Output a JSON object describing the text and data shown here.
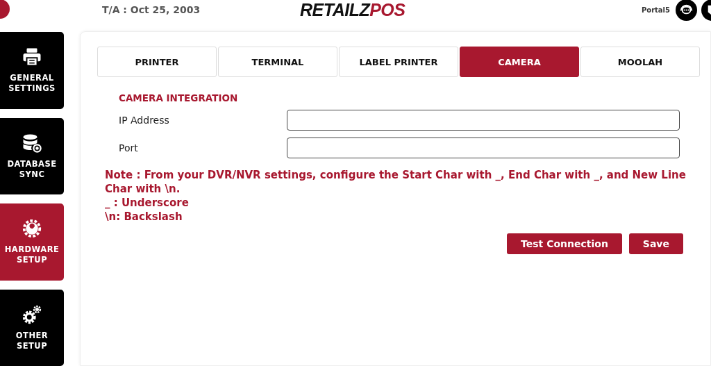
{
  "header": {
    "date": "T/A : Oct 25, 2003",
    "logo": {
      "part_1": "RETAILZ",
      "part_2": "POS"
    },
    "user": "Portal5"
  },
  "sidebar": {
    "items": [
      {
        "label": "GENERAL SETTINGS",
        "kind": "printer",
        "selected": false
      },
      {
        "label": "DATABASE SYNC",
        "kind": "database",
        "selected": false
      },
      {
        "label": "HARDWARE SETUP",
        "kind": "wrench",
        "selected": true
      },
      {
        "label": "OTHER SETUP",
        "kind": "gears",
        "selected": false
      }
    ]
  },
  "tabs": [
    {
      "label": "PRINTER",
      "selected": false
    },
    {
      "label": "TERMINAL",
      "selected": false
    },
    {
      "label": "LABEL PRINTER",
      "selected": false
    },
    {
      "label": "CAMERA",
      "selected": true
    },
    {
      "label": "MOOLAH",
      "selected": false
    }
  ],
  "section_title": "CAMERA INTEGRATION",
  "fields": [
    {
      "label": "IP Address"
    },
    {
      "label": "Port"
    }
  ],
  "notes": [
    "Note : From your DVR/NVR settings, configure the Start Char with _, End Char with _, and New Line Char with \\n.",
    "_ : Underscore",
    "\\n: Backslash"
  ],
  "buttons": [
    "Test Connection",
    "Save"
  ]
}
